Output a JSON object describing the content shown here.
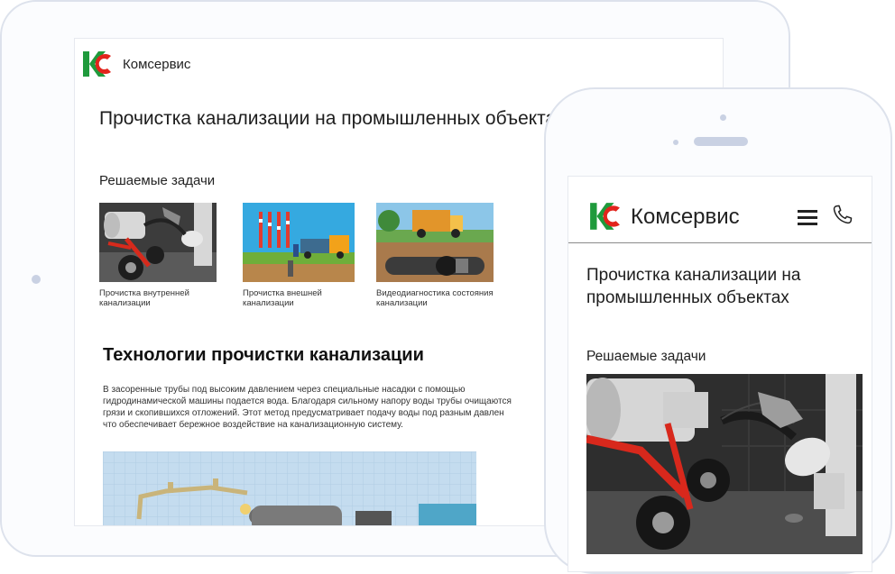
{
  "brand": {
    "name": "Комсервис",
    "colors": {
      "green": "#1f9a3c",
      "red": "#e2241c"
    }
  },
  "tablet": {
    "title": "Прочистка канализации на промышленных объектах",
    "tasks_heading": "Решаемые задачи",
    "cards": [
      {
        "caption": "Прочистка внутренней канализации",
        "image": "drain-cleaning-machine-photo"
      },
      {
        "caption": "Прочистка внешней канализации",
        "image": "external-sewer-illustration"
      },
      {
        "caption": "Видеодиагностика состояния канализации",
        "image": "video-inspection-illustration"
      }
    ],
    "tech_heading": "Технологии прочистки канализации",
    "tech_text": "В засоренные трубы под высоким давлением через специальные насадки с помощью\nгидродинамической машины подается вода. Благодаря сильному напору воды трубы очищаются\nгрязи и скопившихся отложений. Этот метод предусматривает подачу воды под разным давлен\nчто обеспечивает бережное воздействие на канализационную систему."
  },
  "phone": {
    "title": "Прочистка канализации на промышленных объектах",
    "tasks_heading": "Решаемые задачи",
    "menu_icon": "hamburger-menu-icon",
    "call_icon": "phone-icon"
  }
}
